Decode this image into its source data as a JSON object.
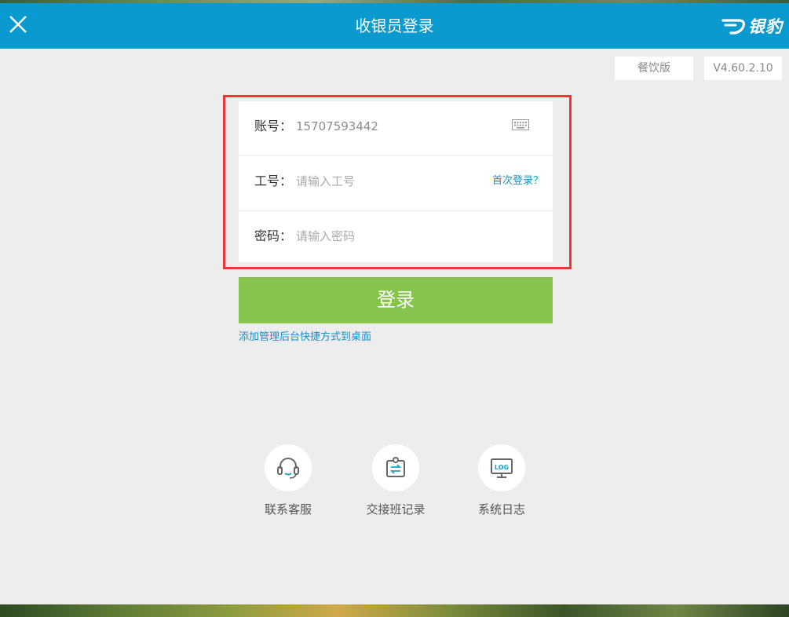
{
  "header": {
    "title": "收银员登录",
    "logo_text": "银豹",
    "bg_color": "#0a9ad0"
  },
  "tags": {
    "edition": "餐饮版",
    "version": "V4.60.2.10"
  },
  "form": {
    "account": {
      "label": "账号：",
      "value": "15707593442"
    },
    "employee_id": {
      "label": "工号：",
      "placeholder": "请输入工号",
      "first_login_link": "首次登录？"
    },
    "password": {
      "label": "密码：",
      "placeholder": "请输入密码"
    },
    "highlight_color": "#ef3434"
  },
  "login_button": {
    "label": "登录",
    "color": "#86c44e"
  },
  "shortcut_link": "添加管理后台快捷方式到桌面",
  "tools": [
    {
      "label": "联系客服",
      "icon": "headset-icon"
    },
    {
      "label": "交接班记录",
      "icon": "shift-handover-icon"
    },
    {
      "label": "系统日志",
      "icon": "log-monitor-icon"
    }
  ]
}
